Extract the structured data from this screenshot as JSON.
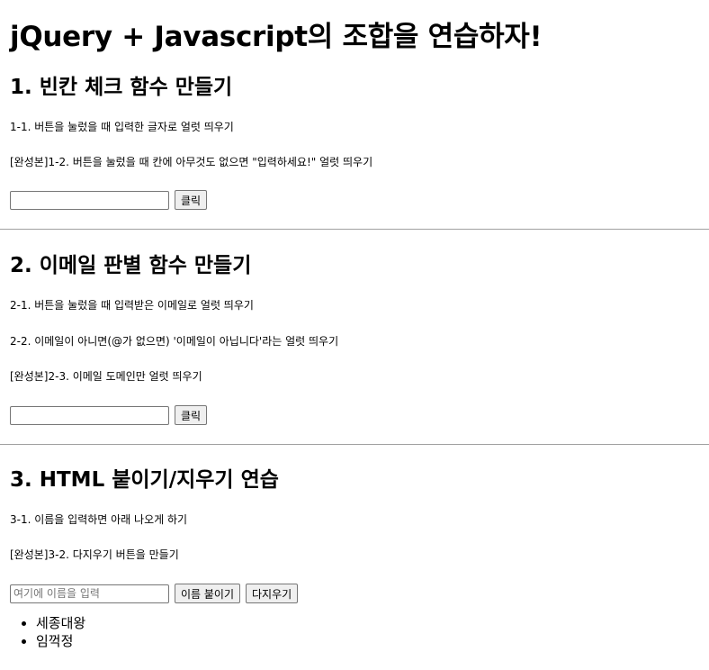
{
  "page_title": "jQuery + Javascript의 조합을 연습하자!",
  "section1": {
    "heading": "1. 빈칸 체크 함수 만들기",
    "item1": "1-1. 버튼을 눌렀을 때 입력한 글자로 얼럿 띄우기",
    "item2": "[완성본]1-2. 버튼을 눌렀을 때 칸에 아무것도 없으면 \"입력하세요!\" 얼럿 띄우기",
    "input_value": "",
    "button_label": "클릭"
  },
  "section2": {
    "heading": "2. 이메일 판별 함수 만들기",
    "item1": "2-1. 버튼을 눌렀을 때 입력받은 이메일로 얼럿 띄우기",
    "item2": "2-2. 이메일이 아니면(@가 없으면) '이메일이 아닙니다'라는 얼럿 띄우기",
    "item3": "[완성본]2-3. 이메일 도메인만 얼럿 띄우기",
    "input_value": "",
    "button_label": "클릭"
  },
  "section3": {
    "heading": "3. HTML 붙이기/지우기 연습",
    "item1": "3-1. 이름을 입력하면 아래 나오게 하기",
    "item2": "[완성본]3-2. 다지우기 버튼을 만들기",
    "input_placeholder": "여기에 이름을 입력",
    "add_button_label": "이름 붙이기",
    "clear_button_label": "다지우기",
    "names": [
      "세종대왕",
      "임꺽정"
    ]
  }
}
